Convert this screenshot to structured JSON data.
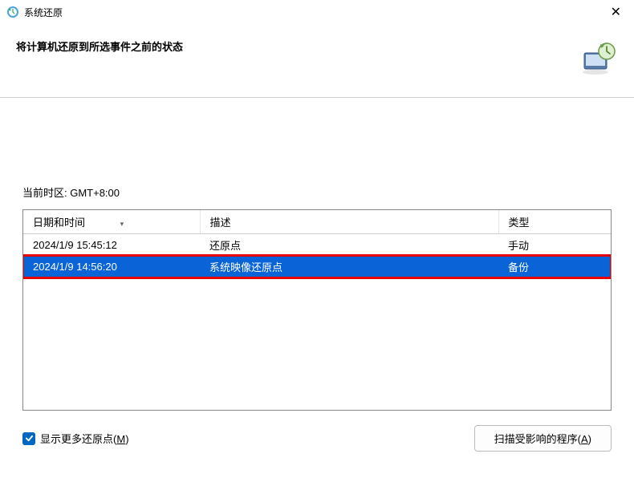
{
  "window": {
    "title": "系统还原"
  },
  "header": {
    "title": "将计算机还原到所选事件之前的状态"
  },
  "timezone_label": "当前时区: GMT+8:00",
  "table": {
    "headers": {
      "datetime": "日期和时间",
      "description": "描述",
      "type": "类型"
    },
    "rows": [
      {
        "datetime": "2024/1/9 15:45:12",
        "description": "还原点",
        "type": "手动",
        "selected": false
      },
      {
        "datetime": "2024/1/9 14:56:20",
        "description": "系统映像还原点",
        "type": "备份",
        "selected": true
      }
    ]
  },
  "footer": {
    "checkbox_label_prefix": "显示更多还原点(",
    "checkbox_label_key": "M",
    "checkbox_label_suffix": ")",
    "scan_button_prefix": "扫描受影响的程序(",
    "scan_button_key": "A",
    "scan_button_suffix": ")"
  }
}
